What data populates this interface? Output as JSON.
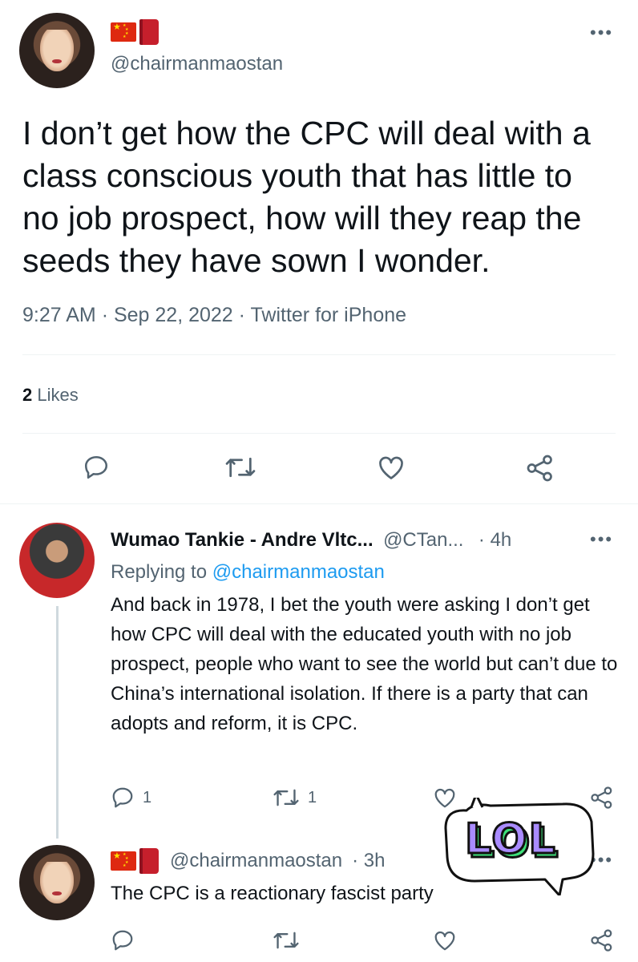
{
  "main_tweet": {
    "handle": "@chairmanmaostan",
    "text": "I don’t get how the CPC will deal with a class conscious youth that has little to no job prospect, how will they reap the seeds they have sown I wonder.",
    "time": "9:27 AM",
    "date": "Sep 22, 2022",
    "source": "Twitter for iPhone",
    "likes_count": "2",
    "likes_label": "Likes"
  },
  "reply1": {
    "name": "Wumao Tankie - Andre Vltc...",
    "handle": "@CTan...",
    "time": "· 4h",
    "replying_prefix": "Replying to",
    "replying_to": "@chairmanmaostan",
    "text": "And back in 1978, I bet the youth were asking I don’t get how CPC will deal with the educated youth with no job prospect, people who want to see the world but can’t due to China’s international isolation. If there is a party that can adopts and reform, it is CPC.",
    "reply_count": "1",
    "retweet_count": "1"
  },
  "reply2": {
    "handle": "@chairmanmaostan",
    "time": "· 3h",
    "text": "The CPC is a reactionary fascist party"
  },
  "overlay": {
    "sticker_text": "LOL"
  },
  "colors": {
    "text": "#0f1419",
    "muted": "#536471",
    "link": "#1d9bf0",
    "sticker_fill": "#a98bff",
    "sticker_shadow": "#3ee07a"
  },
  "icons": [
    "reply-icon",
    "retweet-icon",
    "like-icon",
    "share-icon",
    "more-icon",
    "china-flag-icon",
    "red-book-icon"
  ]
}
